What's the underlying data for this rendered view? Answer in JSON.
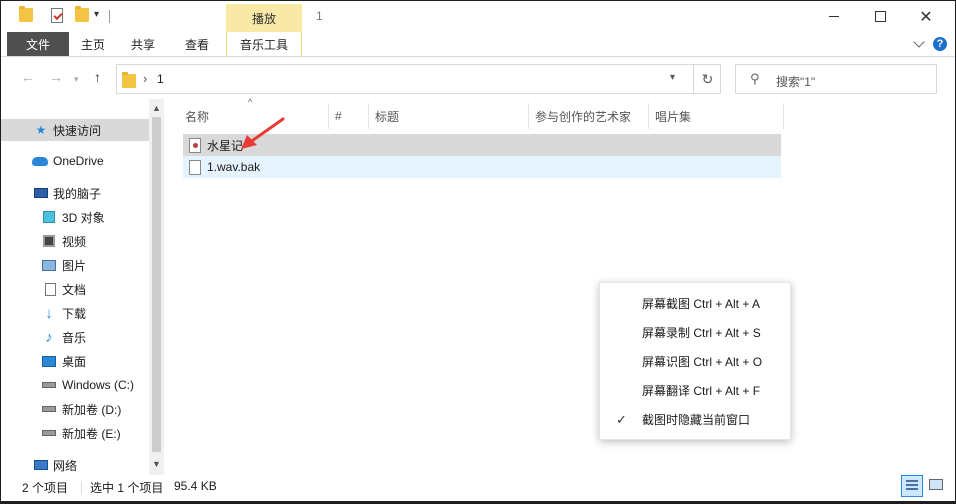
{
  "window": {
    "title": "1",
    "contextual_tab_group": "播放",
    "controls": {
      "minimize": "—",
      "maximize": "☐",
      "close": "✕"
    }
  },
  "ribbon": {
    "tabs": [
      {
        "label": "文件"
      },
      {
        "label": "主页"
      },
      {
        "label": "共享"
      },
      {
        "label": "查看"
      },
      {
        "label": "音乐工具"
      }
    ],
    "help": "?"
  },
  "address": {
    "crumb": "1",
    "search_placeholder": "搜索\"1\""
  },
  "sidebar": {
    "items": [
      {
        "label": "快速访问",
        "icon": "star-icon"
      },
      {
        "label": "OneDrive",
        "icon": "cloud-icon"
      },
      {
        "label": "我的脑子",
        "icon": "computer-icon"
      },
      {
        "label": "3D 对象",
        "icon": "cube-icon"
      },
      {
        "label": "视频",
        "icon": "video-icon"
      },
      {
        "label": "图片",
        "icon": "picture-icon"
      },
      {
        "label": "文档",
        "icon": "document-icon"
      },
      {
        "label": "下载",
        "icon": "download-icon"
      },
      {
        "label": "音乐",
        "icon": "music-icon"
      },
      {
        "label": "桌面",
        "icon": "desktop-icon"
      },
      {
        "label": "Windows (C:)",
        "icon": "drive-icon"
      },
      {
        "label": "新加卷 (D:)",
        "icon": "drive-icon"
      },
      {
        "label": "新加卷 (E:)",
        "icon": "drive-icon"
      },
      {
        "label": "网络",
        "icon": "network-icon"
      }
    ]
  },
  "columns": [
    {
      "label": "名称"
    },
    {
      "label": "#"
    },
    {
      "label": "标题"
    },
    {
      "label": "参与创作的艺术家"
    },
    {
      "label": "唱片集"
    }
  ],
  "files": [
    {
      "name": "水星记",
      "icon": "media-file-icon"
    },
    {
      "name": "1.wav.bak",
      "icon": "file-icon"
    }
  ],
  "context_menu": {
    "items": [
      {
        "label": "屏幕截图 Ctrl + Alt + A",
        "checked": false
      },
      {
        "label": "屏幕录制 Ctrl + Alt + S",
        "checked": false
      },
      {
        "label": "屏幕识图 Ctrl + Alt + O",
        "checked": false
      },
      {
        "label": "屏幕翻译 Ctrl + Alt + F",
        "checked": false
      },
      {
        "label": "截图时隐藏当前窗口",
        "checked": true,
        "check_glyph": "✓"
      }
    ]
  },
  "status": {
    "item_count": "2 个项目",
    "selection": "选中 1 个项目",
    "size": "95.4 KB"
  },
  "colors": {
    "accent": "#2b88d8",
    "annotation": "#e83a36",
    "contextual_tab": "#f9e9a6"
  }
}
